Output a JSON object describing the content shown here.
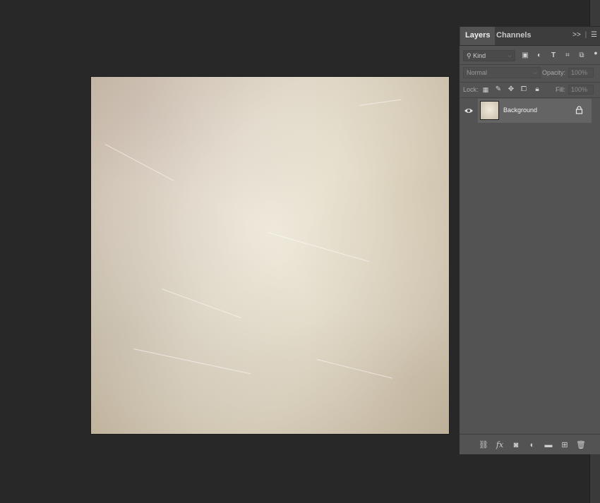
{
  "panel": {
    "tabs": [
      {
        "label": "Layers",
        "active": true
      },
      {
        "label": "Channels",
        "active": false
      }
    ],
    "collapse_glyph": ">>",
    "filter": {
      "kind_label": "Kind",
      "icons": [
        "image-filter-icon",
        "adjustment-filter-icon",
        "type-filter-icon",
        "shape-filter-icon",
        "smart-object-filter-icon"
      ]
    },
    "blend_mode": "Normal",
    "opacity_label": "Opacity:",
    "opacity_value": "100%",
    "lock_label": "Lock:",
    "fill_label": "Fill:",
    "fill_value": "100%",
    "layers": [
      {
        "name": "Background",
        "visible": true,
        "locked": true
      }
    ],
    "footer_icons": [
      "link-layers-icon",
      "fx-icon",
      "add-mask-icon",
      "adjustment-layer-icon",
      "new-group-icon",
      "new-layer-icon",
      "delete-layer-icon"
    ],
    "fx_glyph": "fx"
  },
  "colors": {
    "workspace": "#282828",
    "panel": "#535353",
    "selected_layer": "#646464"
  }
}
